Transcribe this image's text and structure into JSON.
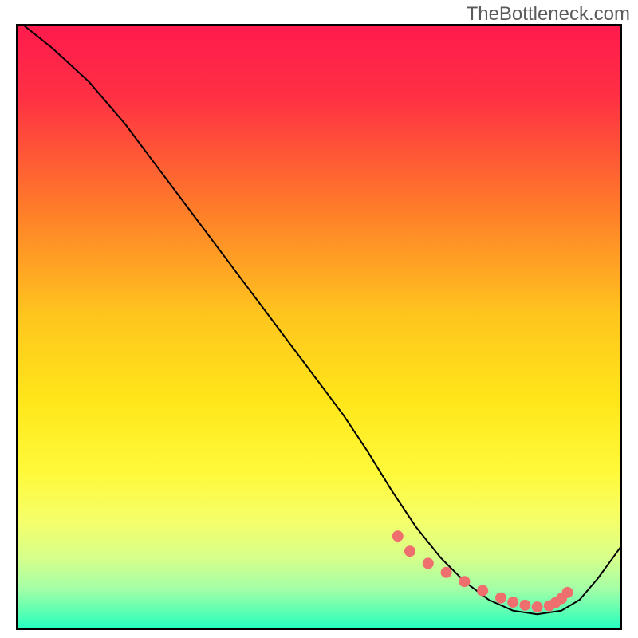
{
  "watermark": "TheBottleneck.com",
  "chart_data": {
    "type": "line",
    "title": "",
    "xlabel": "",
    "ylabel": "",
    "xlim": [
      0,
      100
    ],
    "ylim": [
      0,
      100
    ],
    "grid": false,
    "legend": false,
    "background": {
      "type": "vertical-gradient",
      "stops": [
        {
          "offset": 0.0,
          "color": "#ff1a4d"
        },
        {
          "offset": 0.12,
          "color": "#ff3044"
        },
        {
          "offset": 0.3,
          "color": "#ff7a2a"
        },
        {
          "offset": 0.48,
          "color": "#ffc51e"
        },
        {
          "offset": 0.62,
          "color": "#ffe61a"
        },
        {
          "offset": 0.74,
          "color": "#fff93a"
        },
        {
          "offset": 0.82,
          "color": "#f5ff6a"
        },
        {
          "offset": 0.88,
          "color": "#d7ff8a"
        },
        {
          "offset": 0.93,
          "color": "#a6ffa6"
        },
        {
          "offset": 0.97,
          "color": "#5cffb3"
        },
        {
          "offset": 1.0,
          "color": "#1fffc2"
        }
      ]
    },
    "series": [
      {
        "name": "curve",
        "type": "line",
        "color": "#000000",
        "width": 2,
        "x": [
          1,
          6,
          12,
          18,
          24,
          30,
          36,
          42,
          48,
          54,
          58,
          62,
          66,
          70,
          74,
          78,
          82,
          86,
          90,
          93,
          96,
          100
        ],
        "y": [
          100,
          96,
          90.5,
          83.5,
          75.5,
          67.5,
          59.5,
          51.5,
          43.5,
          35.5,
          29.5,
          23,
          17,
          12,
          8,
          5,
          3.2,
          2.6,
          3.2,
          5,
          8.5,
          14
        ]
      },
      {
        "name": "valley-dots",
        "type": "scatter",
        "color": "#ef6f6f",
        "radius": 7,
        "x": [
          63,
          65,
          68,
          71,
          74,
          77,
          80,
          82,
          84,
          86,
          88,
          89,
          90,
          91
        ],
        "y": [
          15.5,
          13,
          11,
          9.5,
          8,
          6.5,
          5.3,
          4.6,
          4.1,
          3.8,
          4.0,
          4.5,
          5.2,
          6.2
        ]
      }
    ]
  }
}
